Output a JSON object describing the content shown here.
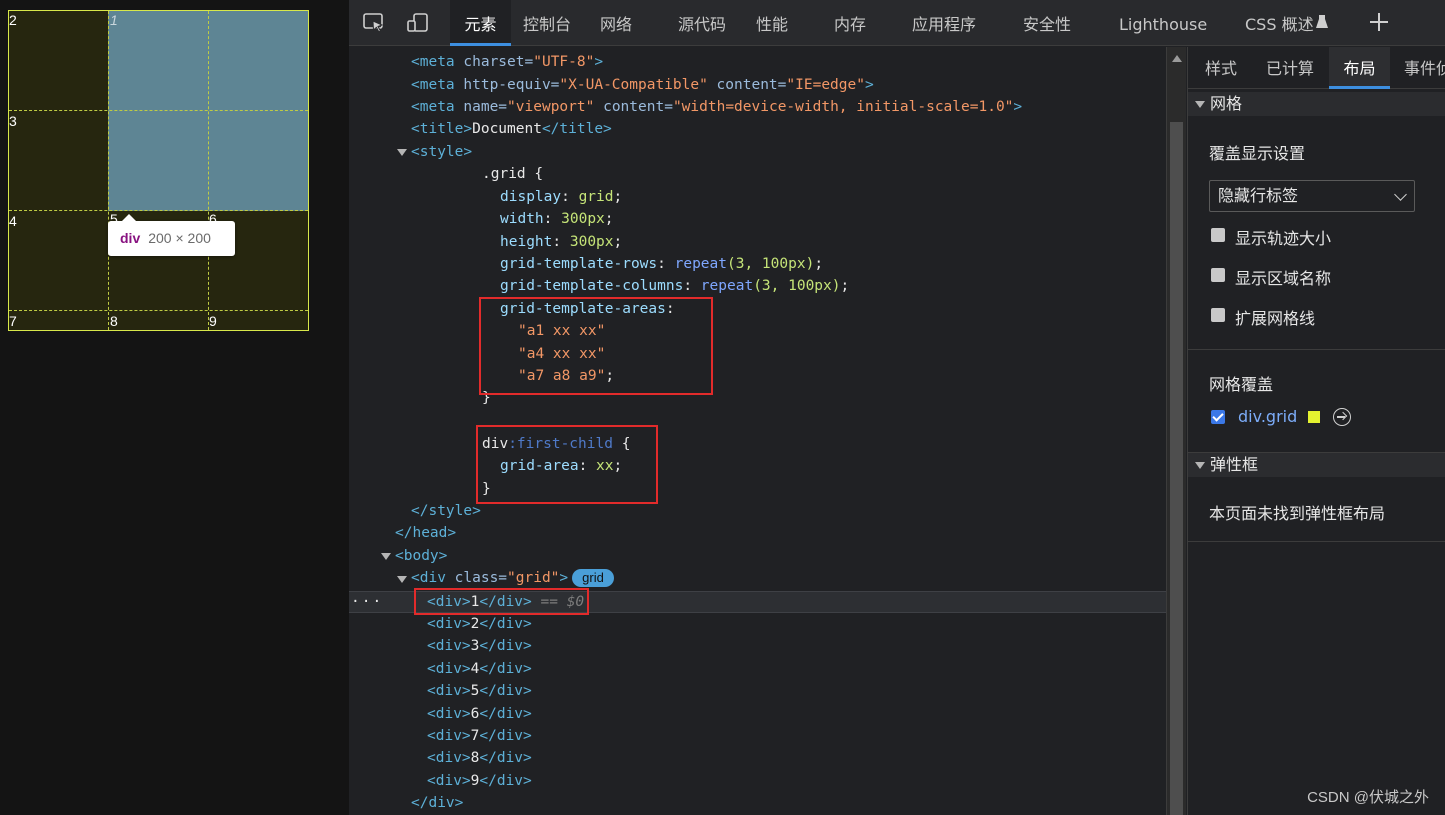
{
  "preview": {
    "cells": [
      "1",
      "2",
      "3",
      "4",
      "5",
      "6",
      "7",
      "8",
      "9"
    ],
    "tooltip": {
      "tag": "div",
      "size": "200 × 200"
    }
  },
  "toolbar": {
    "tabs": [
      "元素",
      "控制台",
      "网络",
      "源代码",
      "性能",
      "内存",
      "应用程序",
      "安全性",
      "Lighthouse",
      "CSS 概述"
    ],
    "active_tab": "元素",
    "icons": [
      "inspect-icon",
      "device-toolbar-icon",
      "experiment-icon",
      "add-tab-icon"
    ]
  },
  "code": {
    "lines": {
      "l1_tag": "<meta",
      "l1_an": " charset=",
      "l1_av": "\"UTF-8\"",
      "l1_end": ">",
      "l2_tag": "<meta",
      "l2_an1": " http-equiv=",
      "l2_av1": "\"X-UA-Compatible\"",
      "l2_an2": " content=",
      "l2_av2": "\"IE=edge\"",
      "l2_end": ">",
      "l3_tag": "<meta",
      "l3_an1": " name=",
      "l3_av1": "\"viewport\"",
      "l3_an2": " content=",
      "l3_av2": "\"width=device-width, initial-scale=1.0\"",
      "l3_end": ">",
      "l4_open": "<title>",
      "l4_text": "Document",
      "l4_close": "</title>",
      "l5": "<style>",
      "l6": ".grid {",
      "l7_p": "display",
      "l7_v": "grid",
      "l8_p": "width",
      "l8_v": "300px",
      "l9_p": "height",
      "l9_v": "300px",
      "l10_p": "grid-template-rows",
      "l10_fn": "repeat",
      "l10_v": "(3, 100px)",
      "l11_p": "grid-template-columns",
      "l11_fn": "repeat",
      "l11_v": "(3, 100px)",
      "l12_p": "grid-template-areas",
      "l13": "\"a1 xx xx\"",
      "l14": "\"a4 xx xx\"",
      "l15": "\"a7 a8 a9\"",
      "l16": "}",
      "l17_sel": "div",
      "l17_ps": ":first-child",
      "l17_end": " {",
      "l18_p": "grid-area",
      "l18_v": "xx",
      "l19": "}",
      "l20": "</style>",
      "l21": "</head>",
      "l22": "<body>",
      "l23_tag": "<div",
      "l23_an": " class=",
      "l23_av": "\"grid\"",
      "l23_end": ">",
      "l23_badge": "grid",
      "l24_open": "<div>",
      "l24_text": "1",
      "l24_close": "</div>",
      "l24_ref": " == $0",
      "child_open": "<div>",
      "child_close": "</div>",
      "children": [
        "2",
        "3",
        "4",
        "5",
        "6",
        "7",
        "8",
        "9"
      ],
      "l33": "</div>"
    },
    "ellipsis": "···"
  },
  "side": {
    "tabs": [
      "样式",
      "已计算",
      "布局",
      "事件侦"
    ],
    "active_tab": "布局",
    "grid_section": "网格",
    "overlay_settings": "覆盖显示设置",
    "dropdown_value": "隐藏行标签",
    "checkboxes": [
      {
        "label": "显示轨迹大小",
        "checked": false
      },
      {
        "label": "显示区域名称",
        "checked": false
      },
      {
        "label": "扩展网格线",
        "checked": false
      }
    ],
    "grid_overlay": "网格覆盖",
    "overlay_item": {
      "label": "div.grid",
      "checked": true,
      "color": "#e4f230"
    },
    "flex_section": "弹性框",
    "flex_empty": "本页面未找到弹性框布局"
  },
  "watermark": "CSDN @伏城之外",
  "colors": {
    "accent": "#3d8fe0",
    "annotation": "#e22b2b",
    "grid_highlight": "#5e8594",
    "grid_line": "#d8e84a"
  }
}
